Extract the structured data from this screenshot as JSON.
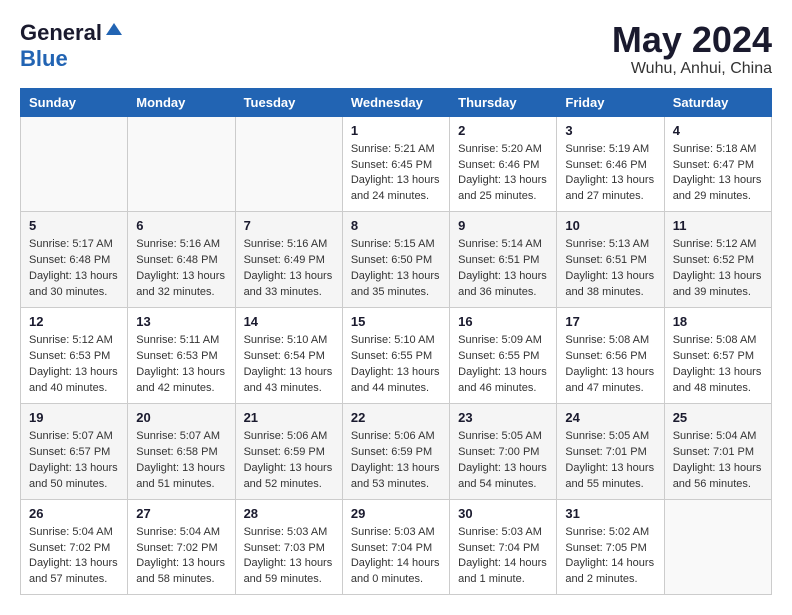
{
  "logo": {
    "general": "General",
    "blue": "Blue"
  },
  "title": {
    "month": "May 2024",
    "location": "Wuhu, Anhui, China"
  },
  "headers": [
    "Sunday",
    "Monday",
    "Tuesday",
    "Wednesday",
    "Thursday",
    "Friday",
    "Saturday"
  ],
  "weeks": [
    [
      {
        "day": "",
        "info": ""
      },
      {
        "day": "",
        "info": ""
      },
      {
        "day": "",
        "info": ""
      },
      {
        "day": "1",
        "info": "Sunrise: 5:21 AM\nSunset: 6:45 PM\nDaylight: 13 hours\nand 24 minutes."
      },
      {
        "day": "2",
        "info": "Sunrise: 5:20 AM\nSunset: 6:46 PM\nDaylight: 13 hours\nand 25 minutes."
      },
      {
        "day": "3",
        "info": "Sunrise: 5:19 AM\nSunset: 6:46 PM\nDaylight: 13 hours\nand 27 minutes."
      },
      {
        "day": "4",
        "info": "Sunrise: 5:18 AM\nSunset: 6:47 PM\nDaylight: 13 hours\nand 29 minutes."
      }
    ],
    [
      {
        "day": "5",
        "info": "Sunrise: 5:17 AM\nSunset: 6:48 PM\nDaylight: 13 hours\nand 30 minutes."
      },
      {
        "day": "6",
        "info": "Sunrise: 5:16 AM\nSunset: 6:48 PM\nDaylight: 13 hours\nand 32 minutes."
      },
      {
        "day": "7",
        "info": "Sunrise: 5:16 AM\nSunset: 6:49 PM\nDaylight: 13 hours\nand 33 minutes."
      },
      {
        "day": "8",
        "info": "Sunrise: 5:15 AM\nSunset: 6:50 PM\nDaylight: 13 hours\nand 35 minutes."
      },
      {
        "day": "9",
        "info": "Sunrise: 5:14 AM\nSunset: 6:51 PM\nDaylight: 13 hours\nand 36 minutes."
      },
      {
        "day": "10",
        "info": "Sunrise: 5:13 AM\nSunset: 6:51 PM\nDaylight: 13 hours\nand 38 minutes."
      },
      {
        "day": "11",
        "info": "Sunrise: 5:12 AM\nSunset: 6:52 PM\nDaylight: 13 hours\nand 39 minutes."
      }
    ],
    [
      {
        "day": "12",
        "info": "Sunrise: 5:12 AM\nSunset: 6:53 PM\nDaylight: 13 hours\nand 40 minutes."
      },
      {
        "day": "13",
        "info": "Sunrise: 5:11 AM\nSunset: 6:53 PM\nDaylight: 13 hours\nand 42 minutes."
      },
      {
        "day": "14",
        "info": "Sunrise: 5:10 AM\nSunset: 6:54 PM\nDaylight: 13 hours\nand 43 minutes."
      },
      {
        "day": "15",
        "info": "Sunrise: 5:10 AM\nSunset: 6:55 PM\nDaylight: 13 hours\nand 44 minutes."
      },
      {
        "day": "16",
        "info": "Sunrise: 5:09 AM\nSunset: 6:55 PM\nDaylight: 13 hours\nand 46 minutes."
      },
      {
        "day": "17",
        "info": "Sunrise: 5:08 AM\nSunset: 6:56 PM\nDaylight: 13 hours\nand 47 minutes."
      },
      {
        "day": "18",
        "info": "Sunrise: 5:08 AM\nSunset: 6:57 PM\nDaylight: 13 hours\nand 48 minutes."
      }
    ],
    [
      {
        "day": "19",
        "info": "Sunrise: 5:07 AM\nSunset: 6:57 PM\nDaylight: 13 hours\nand 50 minutes."
      },
      {
        "day": "20",
        "info": "Sunrise: 5:07 AM\nSunset: 6:58 PM\nDaylight: 13 hours\nand 51 minutes."
      },
      {
        "day": "21",
        "info": "Sunrise: 5:06 AM\nSunset: 6:59 PM\nDaylight: 13 hours\nand 52 minutes."
      },
      {
        "day": "22",
        "info": "Sunrise: 5:06 AM\nSunset: 6:59 PM\nDaylight: 13 hours\nand 53 minutes."
      },
      {
        "day": "23",
        "info": "Sunrise: 5:05 AM\nSunset: 7:00 PM\nDaylight: 13 hours\nand 54 minutes."
      },
      {
        "day": "24",
        "info": "Sunrise: 5:05 AM\nSunset: 7:01 PM\nDaylight: 13 hours\nand 55 minutes."
      },
      {
        "day": "25",
        "info": "Sunrise: 5:04 AM\nSunset: 7:01 PM\nDaylight: 13 hours\nand 56 minutes."
      }
    ],
    [
      {
        "day": "26",
        "info": "Sunrise: 5:04 AM\nSunset: 7:02 PM\nDaylight: 13 hours\nand 57 minutes."
      },
      {
        "day": "27",
        "info": "Sunrise: 5:04 AM\nSunset: 7:02 PM\nDaylight: 13 hours\nand 58 minutes."
      },
      {
        "day": "28",
        "info": "Sunrise: 5:03 AM\nSunset: 7:03 PM\nDaylight: 13 hours\nand 59 minutes."
      },
      {
        "day": "29",
        "info": "Sunrise: 5:03 AM\nSunset: 7:04 PM\nDaylight: 14 hours\nand 0 minutes."
      },
      {
        "day": "30",
        "info": "Sunrise: 5:03 AM\nSunset: 7:04 PM\nDaylight: 14 hours\nand 1 minute."
      },
      {
        "day": "31",
        "info": "Sunrise: 5:02 AM\nSunset: 7:05 PM\nDaylight: 14 hours\nand 2 minutes."
      },
      {
        "day": "",
        "info": ""
      }
    ]
  ]
}
